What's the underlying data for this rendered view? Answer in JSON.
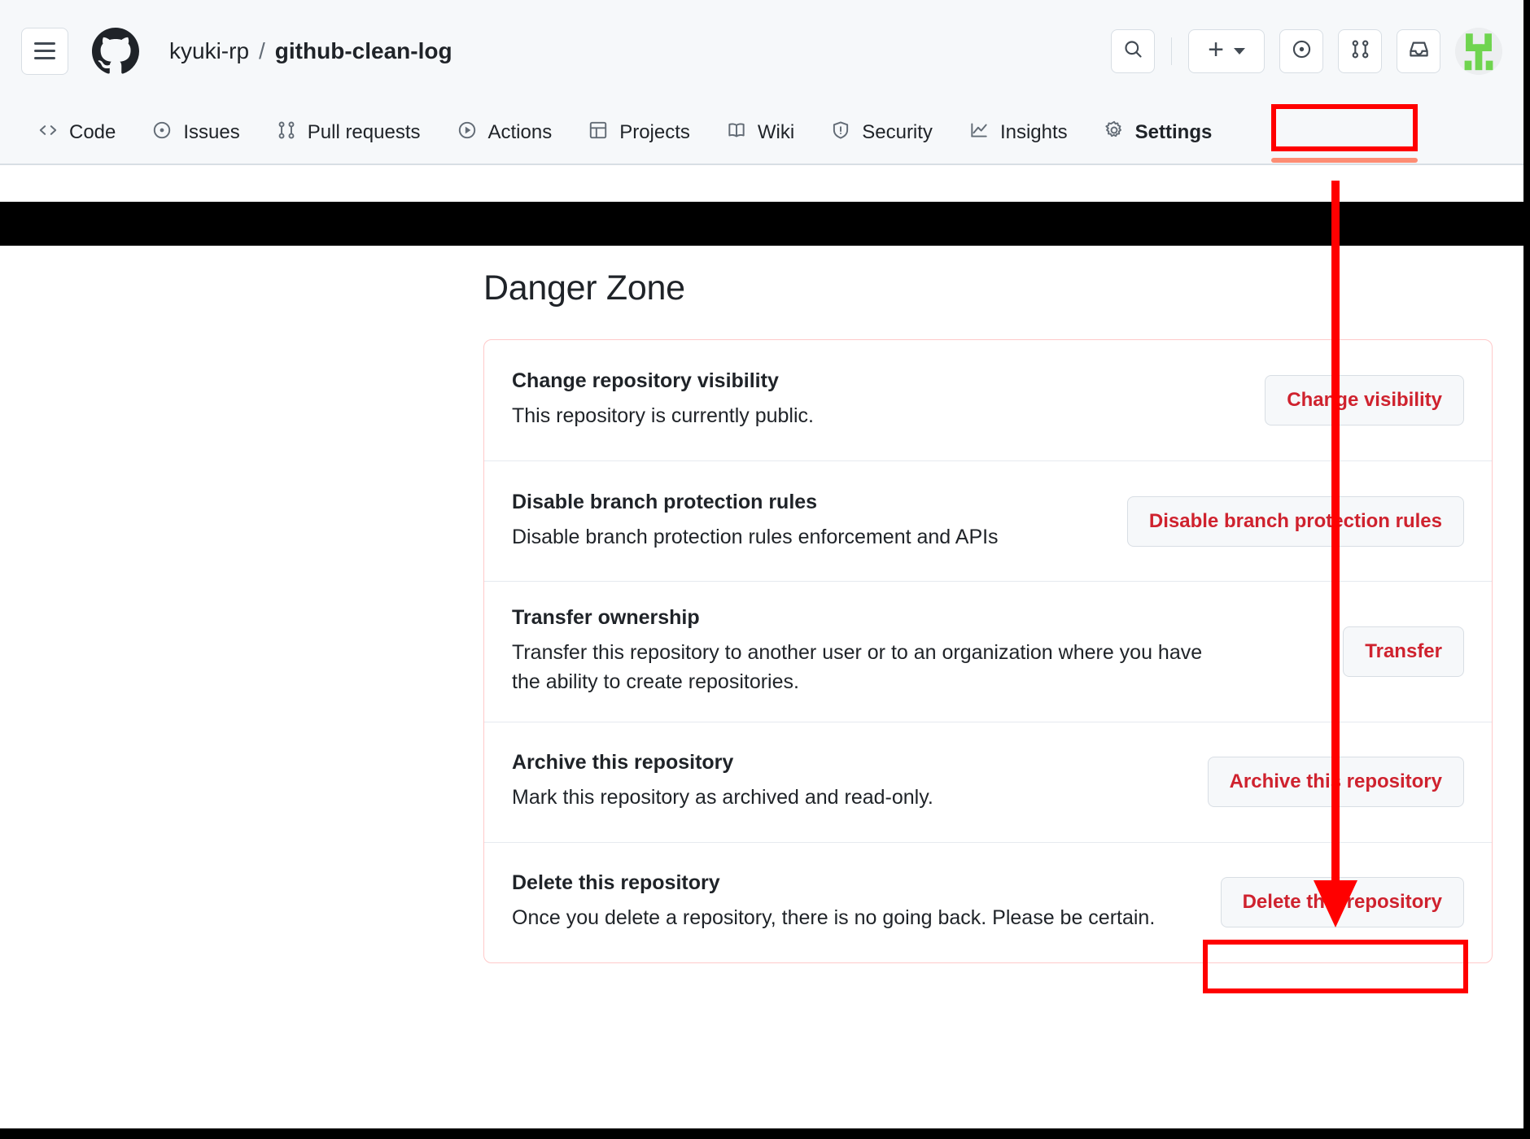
{
  "header": {
    "menu_label": "Open menu",
    "owner": "kyuki-rp",
    "separator": "/",
    "repo": "github-clean-log",
    "icons": {
      "hamburger": "hamburger-icon",
      "logo": "github-logo-icon",
      "search": "search-icon",
      "plus": "plus-icon",
      "caret": "chevron-down-icon",
      "issues": "issue-opened-icon",
      "pull_requests": "git-pull-request-icon",
      "inbox": "inbox-icon",
      "avatar": "avatar"
    },
    "plus_glyph": "+"
  },
  "nav": {
    "tabs": [
      {
        "label": "Code",
        "icon": "code-icon",
        "active": false
      },
      {
        "label": "Issues",
        "icon": "issue-opened-icon",
        "active": false
      },
      {
        "label": "Pull requests",
        "icon": "git-pull-request-icon",
        "active": false
      },
      {
        "label": "Actions",
        "icon": "play-icon",
        "active": false
      },
      {
        "label": "Projects",
        "icon": "table-icon",
        "active": false
      },
      {
        "label": "Wiki",
        "icon": "book-icon",
        "active": false
      },
      {
        "label": "Security",
        "icon": "shield-icon",
        "active": false
      },
      {
        "label": "Insights",
        "icon": "graph-icon",
        "active": false
      },
      {
        "label": "Settings",
        "icon": "gear-icon",
        "active": true
      }
    ]
  },
  "main": {
    "title": "Danger Zone",
    "rows": [
      {
        "title": "Change repository visibility",
        "desc": "This repository is currently public.",
        "button": "Change visibility"
      },
      {
        "title": "Disable branch protection rules",
        "desc": "Disable branch protection rules enforcement and APIs",
        "button": "Disable branch protection rules"
      },
      {
        "title": "Transfer ownership",
        "desc": "Transfer this repository to another user or to an organization where you have the ability to create repositories.",
        "button": "Transfer"
      },
      {
        "title": "Archive this repository",
        "desc": "Mark this repository as archived and read-only.",
        "button": "Archive this repository"
      },
      {
        "title": "Delete this repository",
        "desc": "Once you delete a repository, there is no going back. Please be certain.",
        "button": "Delete this repository"
      }
    ]
  },
  "annotations": {
    "highlight_color": "#ff0000",
    "active_tab_underline_color": "#fd8c73",
    "danger_text_color": "#cf222e",
    "highlighted_elements": [
      "Settings",
      "Delete this repository"
    ]
  }
}
